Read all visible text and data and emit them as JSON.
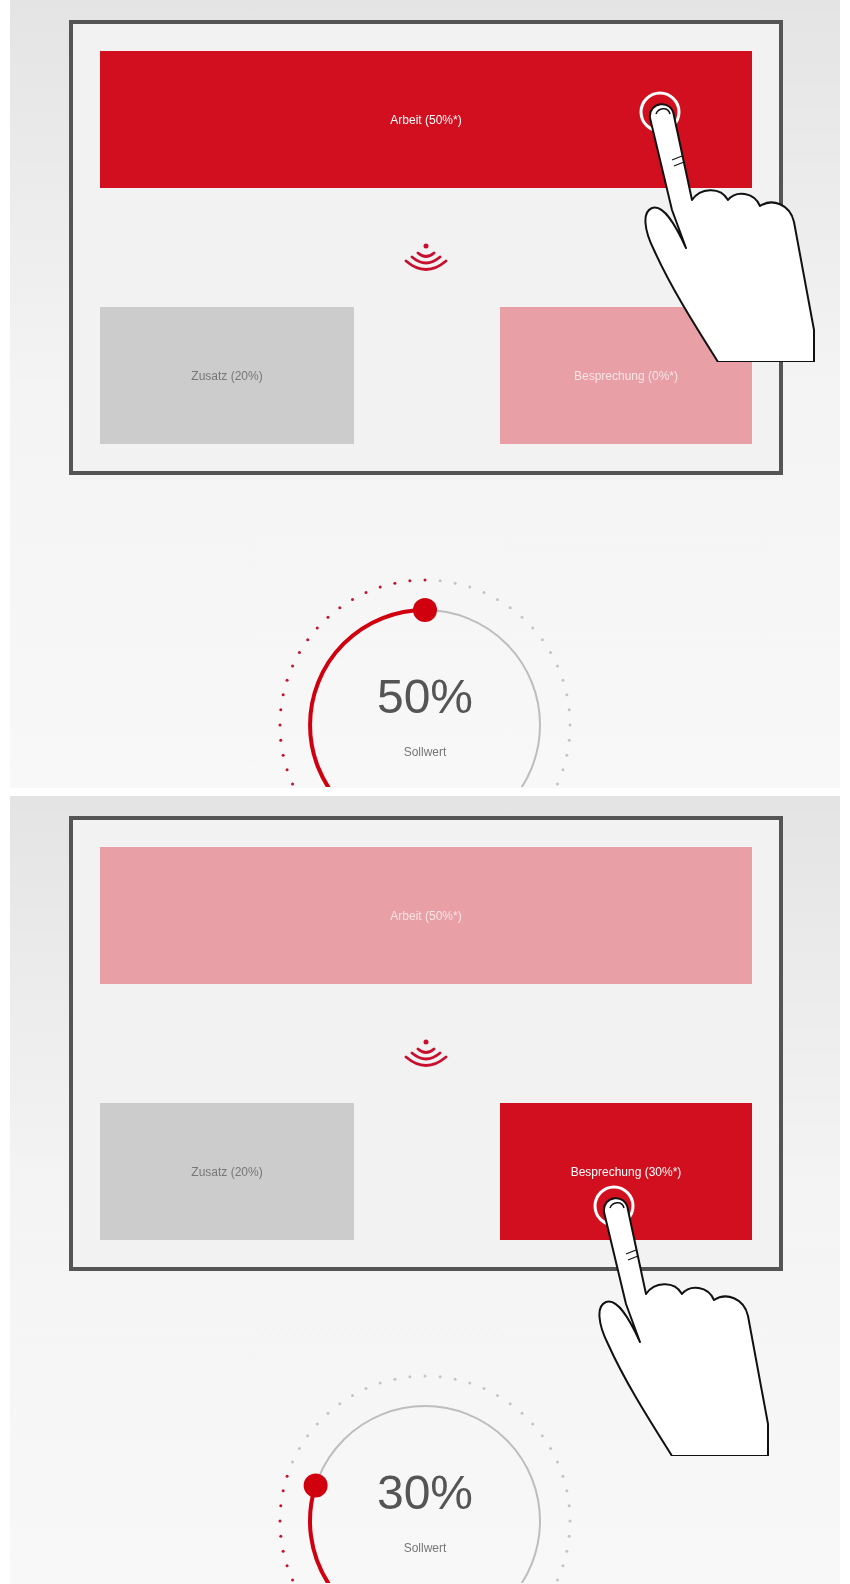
{
  "panels": [
    {
      "buttons": [
        {
          "label": "Arbeit (50%*)",
          "kind": "accent",
          "selected": true,
          "touched": true
        },
        {
          "label": "Zusatz (20%)",
          "kind": "neutral",
          "selected": false,
          "touched": false
        },
        {
          "label": "Besprechung (0%*)",
          "kind": "accent",
          "selected": false,
          "touched": false
        }
      ],
      "dial": {
        "value": "50%",
        "label": "Sollwert",
        "level": 0.5
      }
    },
    {
      "buttons": [
        {
          "label": "Arbeit (50%*)",
          "kind": "accent",
          "selected": false,
          "touched": false
        },
        {
          "label": "Zusatz (20%)",
          "kind": "neutral",
          "selected": false,
          "touched": false
        },
        {
          "label": "Besprechung (30%*)",
          "kind": "accent",
          "selected": true,
          "touched": true
        }
      ],
      "dial": {
        "value": "30%",
        "label": "Sollwert",
        "level": 0.3
      }
    }
  ]
}
